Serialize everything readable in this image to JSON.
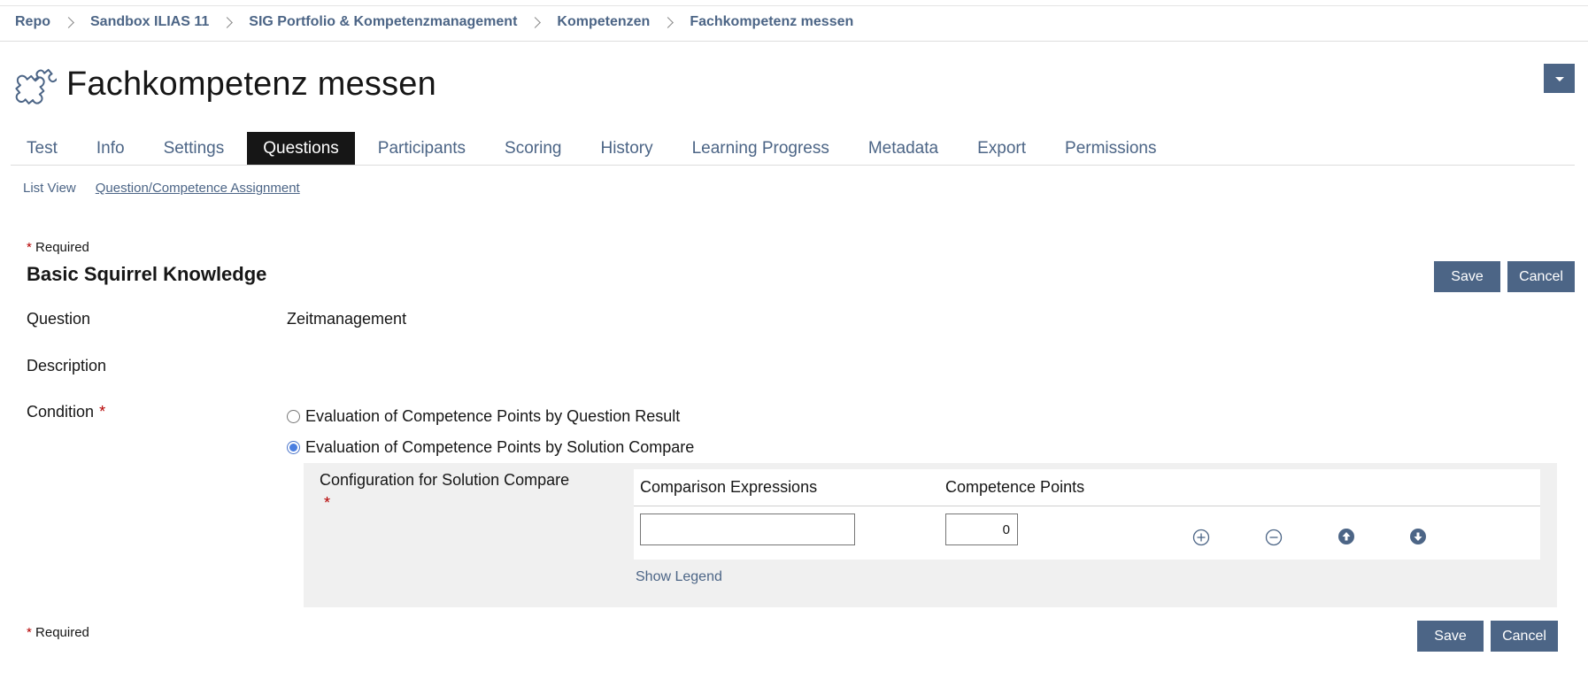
{
  "breadcrumb": {
    "items": [
      "Repo",
      "Sandbox ILIAS 11",
      "SIG Portfolio & Kompetenzmanagement",
      "Kompetenzen",
      "Fachkompetenz messen"
    ]
  },
  "header": {
    "title": "Fachkompetenz messen",
    "icon": "puzzle-icon"
  },
  "tabs": [
    {
      "label": "Test"
    },
    {
      "label": "Info"
    },
    {
      "label": "Settings"
    },
    {
      "label": "Questions",
      "active": true
    },
    {
      "label": "Participants"
    },
    {
      "label": "Scoring"
    },
    {
      "label": "History"
    },
    {
      "label": "Learning Progress"
    },
    {
      "label": "Metadata"
    },
    {
      "label": "Export"
    },
    {
      "label": "Permissions"
    }
  ],
  "subtabs": [
    {
      "label": "List View"
    },
    {
      "label": "Question/Competence Assignment",
      "active": true
    }
  ],
  "form": {
    "required_star": "*",
    "required_label": "Required",
    "title": "Basic Squirrel Knowledge",
    "save_label": "Save",
    "cancel_label": "Cancel",
    "question_label": "Question",
    "question_value": "Zeitmanagement",
    "description_label": "Description",
    "condition_label": "Condition",
    "condition_options": [
      {
        "label": "Evaluation of Competence Points by Question Result",
        "checked": false
      },
      {
        "label": "Evaluation of Competence Points by Solution Compare",
        "checked": true
      }
    ],
    "config_label": "Configuration for Solution Compare",
    "table": {
      "col_expressions": "Comparison Expressions",
      "col_points": "Competence Points",
      "rows": [
        {
          "expression": "",
          "points": "0"
        }
      ],
      "row_actions": [
        "add-icon",
        "remove-icon",
        "move-up-icon",
        "move-down-icon"
      ]
    },
    "show_legend": "Show Legend"
  },
  "colors": {
    "accent": "#4c6586",
    "required": "#b50000",
    "active_tab_bg": "#161616",
    "panel_bg": "#f0f0f0"
  }
}
